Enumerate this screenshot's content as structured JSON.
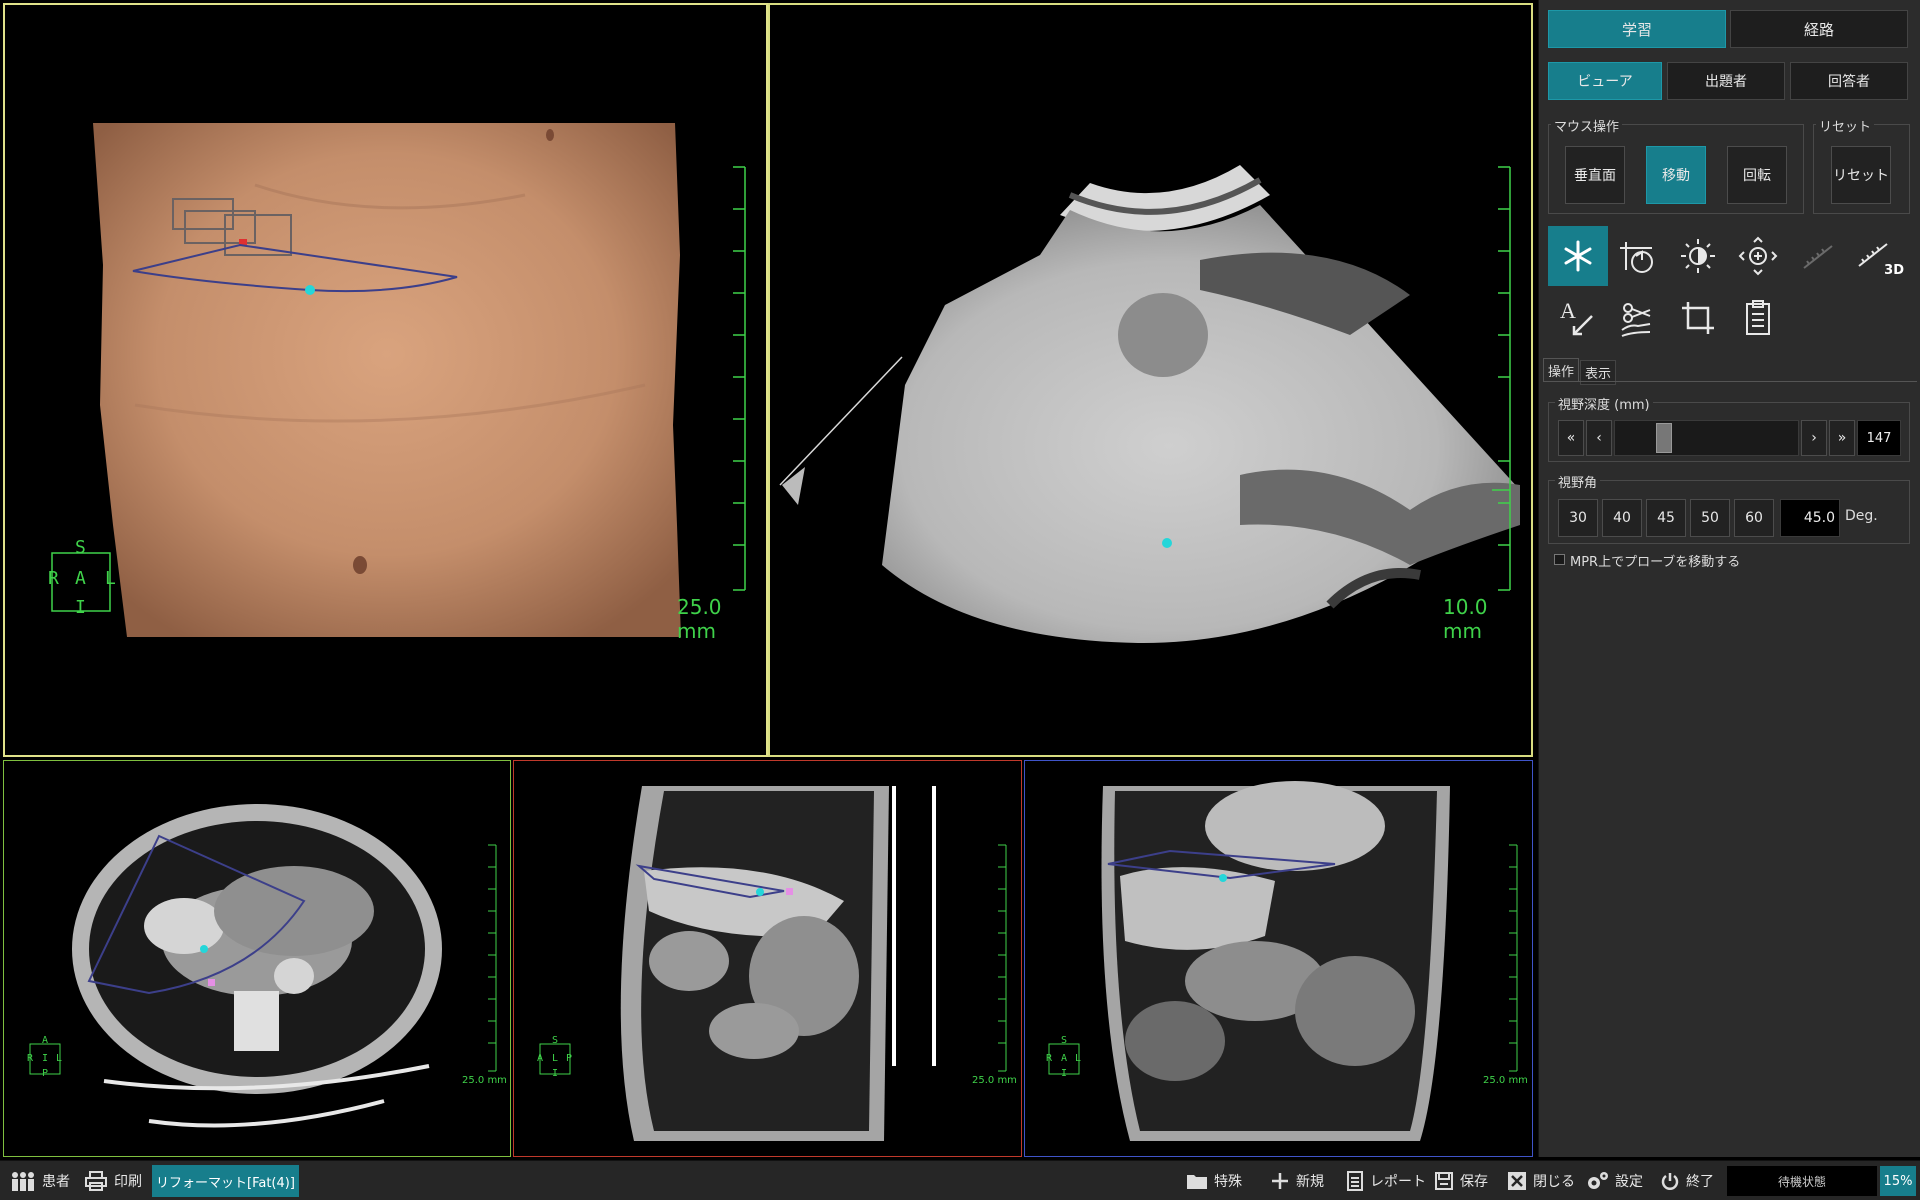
{
  "viewports": {
    "volume": {
      "scale": "25.0 mm",
      "orientation": {
        "top": "S",
        "left": "R",
        "center": "A",
        "right": "L",
        "bottom": "I"
      }
    },
    "ultrasound": {
      "scale": "10.0 mm"
    },
    "axial": {
      "scale": "25.0 mm",
      "orientation": {
        "top": "A",
        "left": "R",
        "center": "I",
        "right": "L",
        "bottom": "P"
      }
    },
    "sagittal": {
      "scale": "25.0 mm",
      "orientation": {
        "top": "S",
        "left": "A",
        "center": "L",
        "right": "P",
        "bottom": "I"
      }
    },
    "coronal": {
      "scale": "25.0 mm",
      "orientation": {
        "top": "S",
        "left": "R",
        "center": "A",
        "right": "L",
        "bottom": "I"
      }
    }
  },
  "panel": {
    "top_tabs": [
      "学習",
      "経路"
    ],
    "sub_tabs": [
      "ビューア",
      "出題者",
      "回答者"
    ],
    "mouse_group": {
      "title": "マウス操作",
      "buttons": [
        "垂直面",
        "移動",
        "回転"
      ]
    },
    "reset_group": {
      "title": "リセット",
      "button": "リセット"
    },
    "tool_icons": [
      "asterisk-icon",
      "rotate-icon",
      "brightness-icon",
      "zoom-move-icon",
      "ruler-icon",
      "ruler-3d-icon",
      "text-annotation-icon",
      "cut-icon",
      "crop-icon",
      "clipboard-icon"
    ],
    "ruler3d_label": "3D",
    "mode_tabs": [
      "操作",
      "表示"
    ],
    "depth": {
      "title": "視野深度 (mm)",
      "value": "147",
      "level": 0.25
    },
    "angle": {
      "title": "視野角",
      "presets": [
        "30",
        "40",
        "45",
        "50",
        "60"
      ],
      "value": "45.0",
      "unit": "Deg."
    },
    "probe_checkbox": "MPR上でプローブを移動する"
  },
  "bottombar": {
    "patient": "患者",
    "print": "印刷",
    "reformat_tab": "リフォーマット[Fat(4)]",
    "special": "特殊",
    "new": "新規",
    "report": "レポート",
    "save": "保存",
    "close": "閉じる",
    "settings": "設定",
    "exit": "終了",
    "status": "待機状態",
    "percent": "15%"
  }
}
